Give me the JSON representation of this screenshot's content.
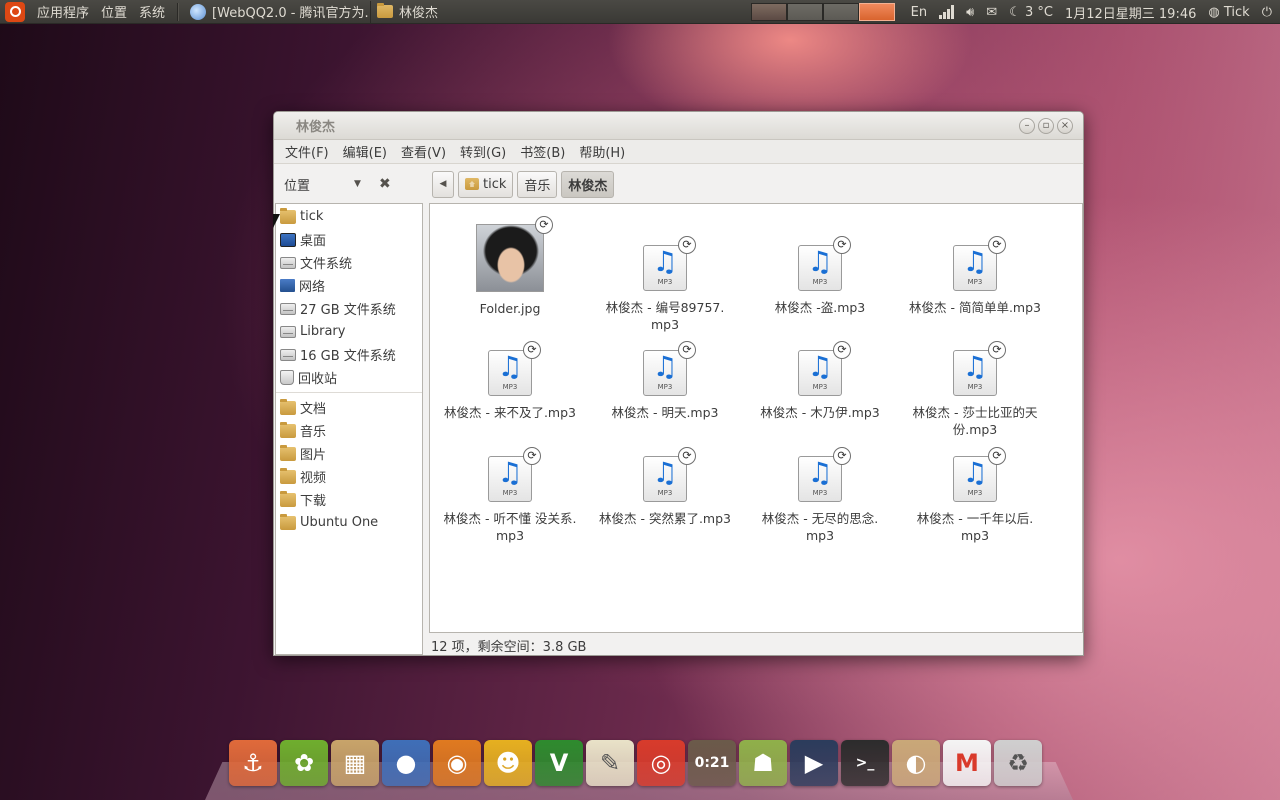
{
  "top_panel": {
    "menus": [
      "应用程序",
      "位置",
      "系统"
    ],
    "tasks": [
      {
        "label": "[WebQQ2.0 - 腾讯官方为...",
        "icon": "webqq-icon"
      },
      {
        "label": "林俊杰",
        "icon": "folder-icon"
      }
    ],
    "keyboard": "En",
    "weather": "3 °C",
    "clock": "1月12日星期三 19:46",
    "user": "Tick"
  },
  "window": {
    "title": "林俊杰",
    "menus": [
      "文件(F)",
      "编辑(E)",
      "查看(V)",
      "转到(G)",
      "书签(B)",
      "帮助(H)"
    ],
    "side_header": "位置",
    "breadcrumbs": [
      "tick",
      "音乐",
      "林俊杰"
    ],
    "sidebar_places": [
      {
        "label": "tick",
        "icon": "home-folder-icon"
      },
      {
        "label": "桌面",
        "icon": "desktop-icon"
      },
      {
        "label": "文件系统",
        "icon": "drive-icon"
      },
      {
        "label": "网络",
        "icon": "network-icon"
      },
      {
        "label": "27 GB 文件系统",
        "icon": "drive-icon"
      },
      {
        "label": "Library",
        "icon": "drive-icon"
      },
      {
        "label": "16 GB 文件系统",
        "icon": "drive-icon"
      },
      {
        "label": "回收站",
        "icon": "trash-icon"
      }
    ],
    "sidebar_bookmarks": [
      {
        "label": "文档",
        "icon": "folder-icon"
      },
      {
        "label": "音乐",
        "icon": "folder-icon"
      },
      {
        "label": "图片",
        "icon": "folder-icon"
      },
      {
        "label": "视频",
        "icon": "folder-icon"
      },
      {
        "label": "下载",
        "icon": "folder-icon"
      },
      {
        "label": "Ubuntu One",
        "icon": "folder-icon"
      }
    ],
    "files": [
      {
        "name_lines": [
          "Folder.jpg"
        ],
        "type": "image"
      },
      {
        "name_lines": [
          "林俊杰 - 编号89757.",
          "mp3"
        ],
        "type": "mp3"
      },
      {
        "name_lines": [
          "林俊杰 -盗.mp3"
        ],
        "type": "mp3"
      },
      {
        "name_lines": [
          "林俊杰 - 简简单单.mp3"
        ],
        "type": "mp3"
      },
      {
        "name_lines": [
          "林俊杰 - 来不及了.mp3"
        ],
        "type": "mp3"
      },
      {
        "name_lines": [
          "林俊杰 - 明天.mp3"
        ],
        "type": "mp3"
      },
      {
        "name_lines": [
          "林俊杰 - 木乃伊.mp3"
        ],
        "type": "mp3"
      },
      {
        "name_lines": [
          "林俊杰 - 莎士比亚的天",
          "份.mp3"
        ],
        "type": "mp3"
      },
      {
        "name_lines": [
          "林俊杰 - 听不懂 没关系.",
          "mp3"
        ],
        "type": "mp3"
      },
      {
        "name_lines": [
          "林俊杰 - 突然累了.mp3"
        ],
        "type": "mp3"
      },
      {
        "name_lines": [
          "林俊杰 - 无尽的思念.",
          "mp3"
        ],
        "type": "mp3"
      },
      {
        "name_lines": [
          "林俊杰 - 一千年以后.",
          "mp3"
        ],
        "type": "mp3"
      }
    ],
    "file_ext_label": "MP3",
    "status": "12 项，剩余空间：3.8 GB"
  },
  "dock": [
    {
      "icon": "anchor-icon",
      "color": "#e06a3a",
      "glyph": "⚓"
    },
    {
      "icon": "ubuntu-settings-icon",
      "color": "#6fae2e",
      "glyph": "✿"
    },
    {
      "icon": "package-installer-icon",
      "color": "#c8a46a",
      "glyph": "▦"
    },
    {
      "icon": "pidgin-icon",
      "color": "#3f6fb8",
      "glyph": "●"
    },
    {
      "icon": "firefox-icon",
      "color": "#e07a20",
      "glyph": "◉"
    },
    {
      "icon": "contacts-icon",
      "color": "#e6b020",
      "glyph": "☻"
    },
    {
      "icon": "vim-icon",
      "color": "#2e8b2e",
      "glyph": "V"
    },
    {
      "icon": "text-editor-icon",
      "color": "#e9e2c8",
      "glyph": "✎"
    },
    {
      "icon": "chrome-icon",
      "color": "#d83b2b",
      "glyph": "◎"
    },
    {
      "icon": "music-player-icon",
      "color": "#6b5a4a",
      "glyph": "0:21"
    },
    {
      "icon": "android-icon",
      "color": "#8fb04a",
      "glyph": "☗"
    },
    {
      "icon": "video-player-icon",
      "color": "#2b3c5c",
      "glyph": "▶"
    },
    {
      "icon": "terminal-icon",
      "color": "#2c2c2c",
      "glyph": ">_"
    },
    {
      "icon": "nautilus-icon",
      "color": "#c9a878",
      "glyph": "◐"
    },
    {
      "icon": "gmail-icon",
      "color": "#f4f4f4",
      "glyph": "M"
    },
    {
      "icon": "trash-icon",
      "color": "#cfcfcf",
      "glyph": "♻"
    }
  ]
}
